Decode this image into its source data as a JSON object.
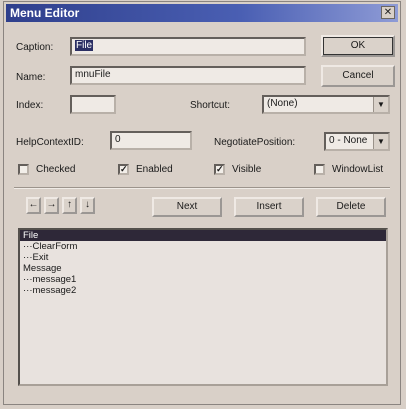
{
  "window": {
    "title": "Menu Editor",
    "close": "✕"
  },
  "fields": {
    "caption_label": "Caption:",
    "caption_value": "File",
    "name_label": "Name:",
    "name_value": "mnuFile",
    "index_label": "Index:",
    "index_value": "",
    "shortcut_label": "Shortcut:",
    "shortcut_value": "(None)",
    "helpcontext_label": "HelpContextID:",
    "helpcontext_value": "0",
    "negotiate_label": "NegotiatePosition:",
    "negotiate_value": "0 - None"
  },
  "checks": {
    "checked_label": "Checked",
    "checked_value": "",
    "enabled_label": "Enabled",
    "enabled_value": "✓",
    "visible_label": "Visible",
    "visible_value": "✓",
    "windowlist_label": "WindowList",
    "windowlist_value": ""
  },
  "buttons": {
    "ok": "OK",
    "cancel": "Cancel",
    "next": "Next",
    "insert": "Insert",
    "delete": "Delete",
    "left": "←",
    "right": "→",
    "up": "↑",
    "down": "↓"
  },
  "menu_list": [
    "File",
    "···ClearForm",
    "···Exit",
    "Message",
    "···message1",
    "···message2"
  ],
  "combo_arrow": "▼"
}
